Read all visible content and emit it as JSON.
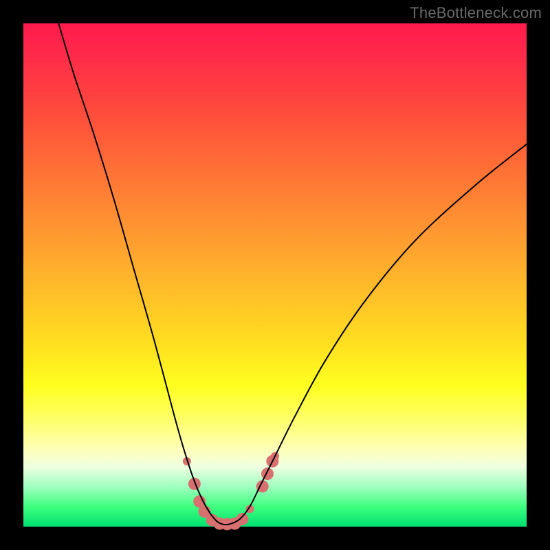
{
  "watermark": "TheBottleneck.com",
  "gradient": {
    "top_color": "#ff1a4d",
    "mid_color": "#ffff20",
    "bottom_color": "#00e070"
  },
  "chart_data": {
    "type": "line",
    "title": "",
    "xlabel": "",
    "ylabel": "",
    "xlim": [
      0,
      100
    ],
    "ylim": [
      0,
      100
    ],
    "grid": false,
    "series": [
      {
        "name": "bottleneck-curve",
        "x": [
          7,
          10,
          14,
          18,
          22,
          26,
          30,
          32,
          34,
          36,
          38,
          39.5,
          41,
          43,
          45,
          47,
          50,
          54,
          60,
          68,
          78,
          90,
          100
        ],
        "y": [
          100,
          90,
          78,
          65,
          51,
          37,
          22,
          15,
          9,
          4.5,
          1.5,
          0.5,
          0.5,
          1.5,
          4,
          8,
          14,
          22,
          33,
          45,
          57,
          68,
          76
        ]
      }
    ],
    "markers": {
      "name": "highlight-points",
      "color": "#d87070",
      "points": [
        {
          "x": 32.5,
          "y": 13,
          "r": 6
        },
        {
          "x": 34.0,
          "y": 8.5,
          "r": 9
        },
        {
          "x": 35.0,
          "y": 5.0,
          "r": 9
        },
        {
          "x": 36.0,
          "y": 3.0,
          "r": 9
        },
        {
          "x": 37.5,
          "y": 1.3,
          "r": 9
        },
        {
          "x": 39.0,
          "y": 0.6,
          "r": 9
        },
        {
          "x": 40.5,
          "y": 0.5,
          "r": 9
        },
        {
          "x": 42.0,
          "y": 0.6,
          "r": 9
        },
        {
          "x": 43.5,
          "y": 1.5,
          "r": 9
        },
        {
          "x": 45.0,
          "y": 3.5,
          "r": 6
        },
        {
          "x": 47.5,
          "y": 8.0,
          "r": 9
        },
        {
          "x": 48.5,
          "y": 10.5,
          "r": 9
        },
        {
          "x": 49.5,
          "y": 13.0,
          "r": 9
        },
        {
          "x": 50.0,
          "y": 14.0,
          "r": 6
        }
      ]
    }
  }
}
